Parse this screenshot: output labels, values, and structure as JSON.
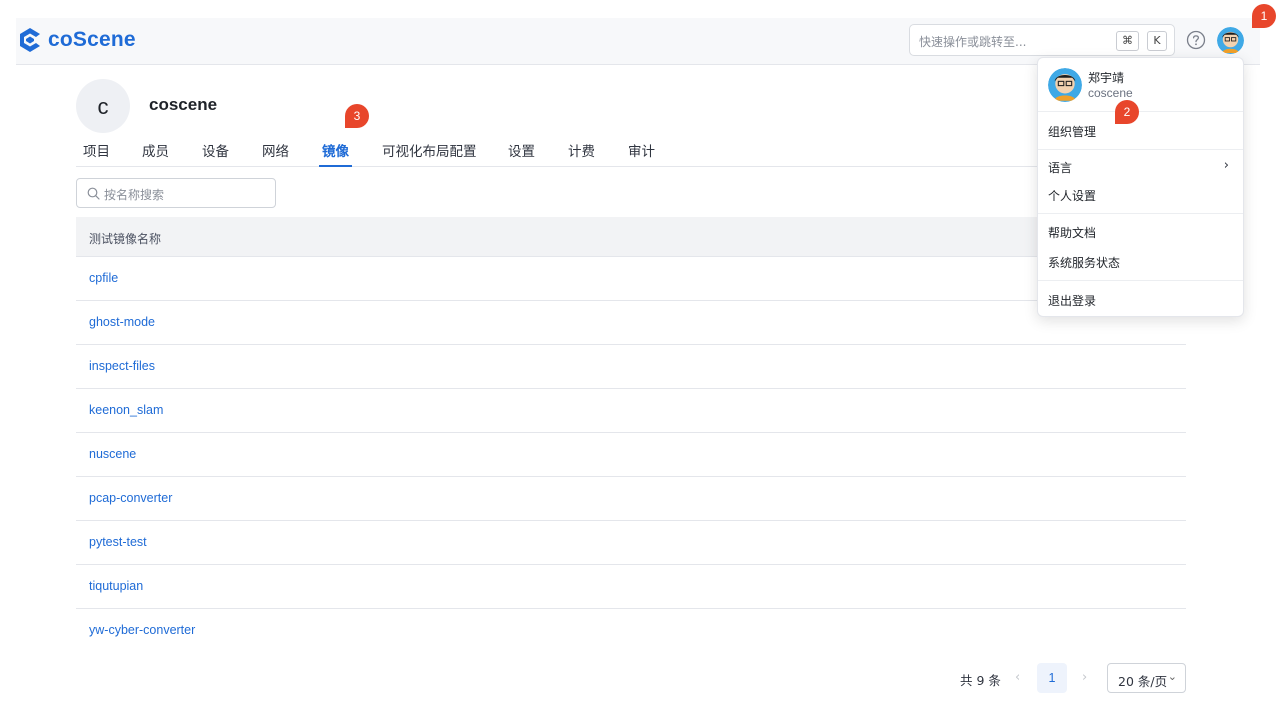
{
  "header": {
    "logo_text": "coScene",
    "command_search_placeholder": "快速操作或跳转至...",
    "shortcut_keys": [
      "⌘",
      "K"
    ]
  },
  "org": {
    "avatar_letter": "c",
    "name": "coscene"
  },
  "tabs": [
    {
      "label": "项目"
    },
    {
      "label": "成员"
    },
    {
      "label": "设备"
    },
    {
      "label": "网络"
    },
    {
      "label": "镜像",
      "active": true
    },
    {
      "label": "可视化布局配置"
    },
    {
      "label": "设置"
    },
    {
      "label": "计费"
    },
    {
      "label": "审计"
    }
  ],
  "search": {
    "placeholder": "按名称搜索"
  },
  "table": {
    "header": "测试镜像名称",
    "rows": [
      "cpfile",
      "ghost-mode",
      "inspect-files",
      "keenon_slam",
      "nuscene",
      "pcap-converter",
      "pytest-test",
      "tiqutupian",
      "yw-cyber-converter"
    ]
  },
  "pagination": {
    "total_label": "共 9 条",
    "current_page": "1",
    "page_size": "20 条/页"
  },
  "user_menu": {
    "user_name": "郑宇靖",
    "org": "coscene",
    "items": [
      "组织管理",
      "语言",
      "个人设置",
      "帮助文档",
      "系统服务状态",
      "退出登录"
    ]
  },
  "markers": [
    "1",
    "2",
    "3"
  ],
  "colors": {
    "accent": "#1f6bd6",
    "marker": "#e8462b"
  }
}
